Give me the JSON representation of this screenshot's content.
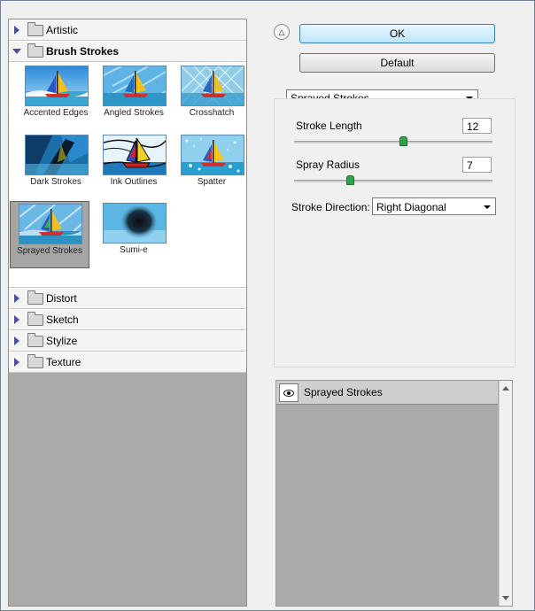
{
  "categories_top": [
    {
      "label": "Artistic",
      "open": false
    },
    {
      "label": "Brush Strokes",
      "open": true
    }
  ],
  "thumbnails": [
    {
      "label": "Accented Edges",
      "selected": false
    },
    {
      "label": "Angled Strokes",
      "selected": false
    },
    {
      "label": "Crosshatch",
      "selected": false
    },
    {
      "label": "Dark Strokes",
      "selected": false
    },
    {
      "label": "Ink Outlines",
      "selected": false
    },
    {
      "label": "Spatter",
      "selected": false
    },
    {
      "label": "Sprayed Strokes",
      "selected": true
    },
    {
      "label": "Sumi-e",
      "selected": false
    }
  ],
  "categories_bottom": [
    {
      "label": "Distort",
      "open": false
    },
    {
      "label": "Sketch",
      "open": false
    },
    {
      "label": "Stylize",
      "open": false
    },
    {
      "label": "Texture",
      "open": false
    }
  ],
  "buttons": {
    "ok": "OK",
    "default": "Default"
  },
  "filter_select": "Sprayed Strokes",
  "params": {
    "stroke_length": {
      "label": "Stroke Length",
      "value": "12",
      "fraction": 0.55
    },
    "spray_radius": {
      "label": "Spray Radius",
      "value": "7",
      "fraction": 0.28
    }
  },
  "stroke_direction": {
    "label": "Stroke Direction:",
    "value": "Right Diagonal"
  },
  "layer": {
    "name": "Sprayed Strokes",
    "icon": "eye-icon"
  },
  "colors": {
    "accent": "#3c7fb1",
    "panel_gray": "#ababab"
  }
}
